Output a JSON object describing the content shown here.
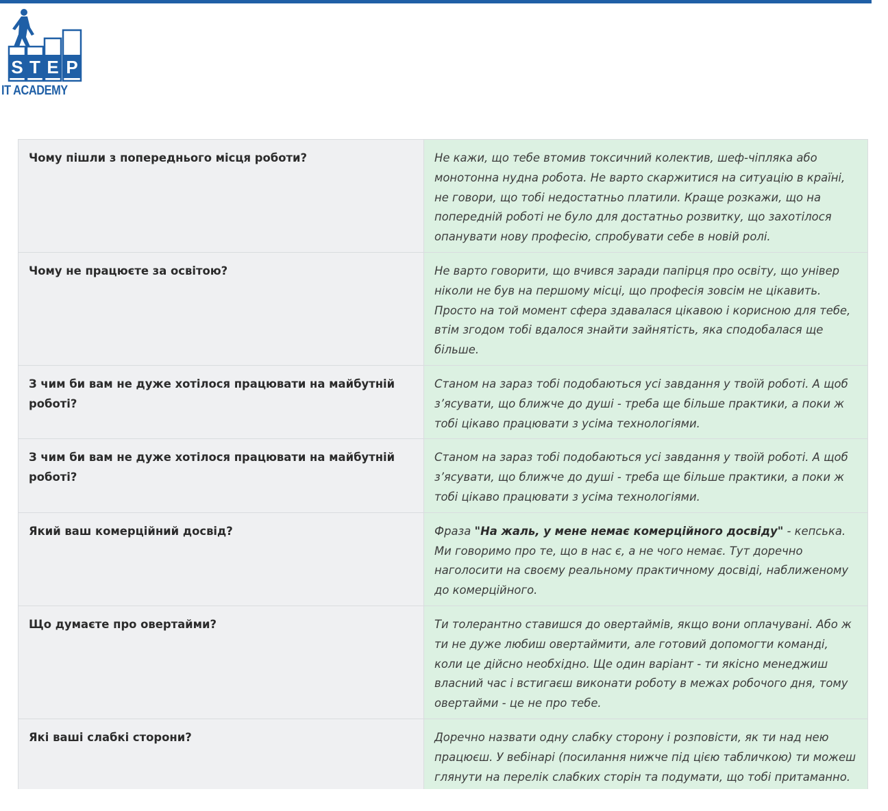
{
  "colors": {
    "brand": "#1f5fa6",
    "question_bg": "#eff0f2",
    "answer_bg": "#dcf1e2"
  },
  "logo": {
    "letters": [
      "S",
      "T",
      "E",
      "P"
    ],
    "subtitle": "IT ACADEMY"
  },
  "faq": [
    {
      "question": "Чому пішли з попереднього місця роботи?",
      "answer": "Не кажи, що тебе втомив токсичний колектив, шеф-чіпляка або монотонна нудна робота. Не варто скаржитися на ситуацію в країні, не говори, що тобі недостатньо платили. Краще розкажи, що на попередній роботі не було для достатньо розвитку, що захотілося опанувати нову професію, спробувати себе в новій ролі."
    },
    {
      "question": "Чому не працюєте за освітою?",
      "answer": "Не варто говорити, що вчився заради папірця про освіту, що універ ніколи не був на першому місці, що професія зовсім не цікавить. Просто на той момент сфера здавалася цікавою і корисною для тебе, втім згодом тобі вдалося знайти зайнятість, яка сподобалася ще більше."
    },
    {
      "question": "З чим би вам не дуже хотілося працювати на майбутній роботі?",
      "answer": "Станом на зараз тобі подобаються усі завдання у твоїй роботі. А щоб з’ясувати, що ближче до душі - треба ще більше практики, а поки ж тобі цікаво працювати з усіма технологіями."
    },
    {
      "question": "З чим би вам не дуже хотілося працювати на майбутній роботі?",
      "answer": "Станом на зараз тобі подобаються усі завдання у твоїй роботі. А щоб з’ясувати, що ближче до душі - треба ще більше практики, а поки ж тобі цікаво працювати з усіма технологіями."
    },
    {
      "question": "Який ваш комерційний досвід?",
      "answer_prefix": "Фраза ",
      "answer_bold": "\"На жаль, у мене немає комерційного досвіду\"",
      "answer": " - кепська. Ми говоримо про те, що в нас є, а не чого немає. Тут доречно наголосити на своєму реальному практичному досвіді, наближеному до комерційного."
    },
    {
      "question": "Що думаєте про овертайми?",
      "answer": "Ти толерантно ставишся до овертаймів, якщо вони оплачувані. Або ж ти не дуже любиш овертаймити, але готовий допомогти команді, коли це дійсно необхідно. Ще один варіант - ти якісно менеджиш власний час і встигаєш виконати роботу в межах робочого дня, тому овертайми - це не про тебе."
    },
    {
      "question": "Які ваші слабкі сторони?",
      "answer": "Доречно назвати одну слабку сторону і розповісти, як ти над нею працюєш. У вебінарі (посилання нижче під цією табличкою) ти можеш глянути на перелік слабких сторін та подумати, що тобі притаманно."
    }
  ]
}
